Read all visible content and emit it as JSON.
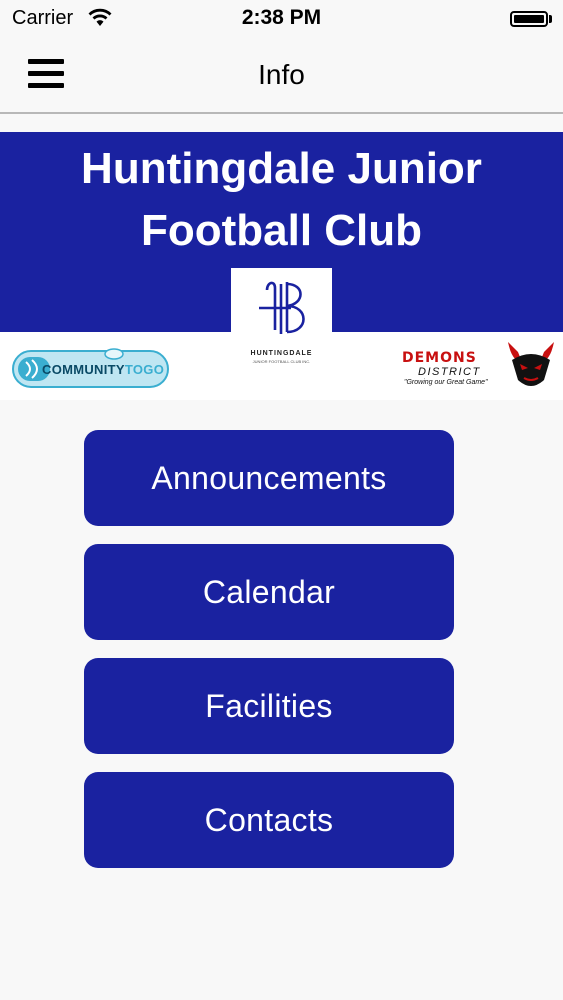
{
  "status_bar": {
    "carrier": "Carrier",
    "time": "2:38 PM"
  },
  "nav": {
    "title": "Info",
    "menu_icon": "hamburger-menu-icon"
  },
  "banner": {
    "title_line1": "Huntingdale Junior",
    "title_line2": "Football Club",
    "background_color": "#1a22a0"
  },
  "club_logo": {
    "caption": "HUNTINGDALE",
    "subcaption": "JUNIOR FOOTBALL CLUB INC."
  },
  "sponsors": {
    "community_to_go": {
      "text_a": "COMMUNITY",
      "text_b": "TOGO"
    },
    "demons_district": {
      "name": "DEMONS",
      "district": "DISTRICT",
      "tagline": "\"Growing our Great Game\""
    }
  },
  "menu": [
    {
      "label": "Announcements"
    },
    {
      "label": "Calendar"
    },
    {
      "label": "Facilities"
    },
    {
      "label": "Contacts"
    }
  ],
  "colors": {
    "accent": "#1a22a0",
    "button_text": "#ffffff",
    "background": "#f8f8f8"
  }
}
